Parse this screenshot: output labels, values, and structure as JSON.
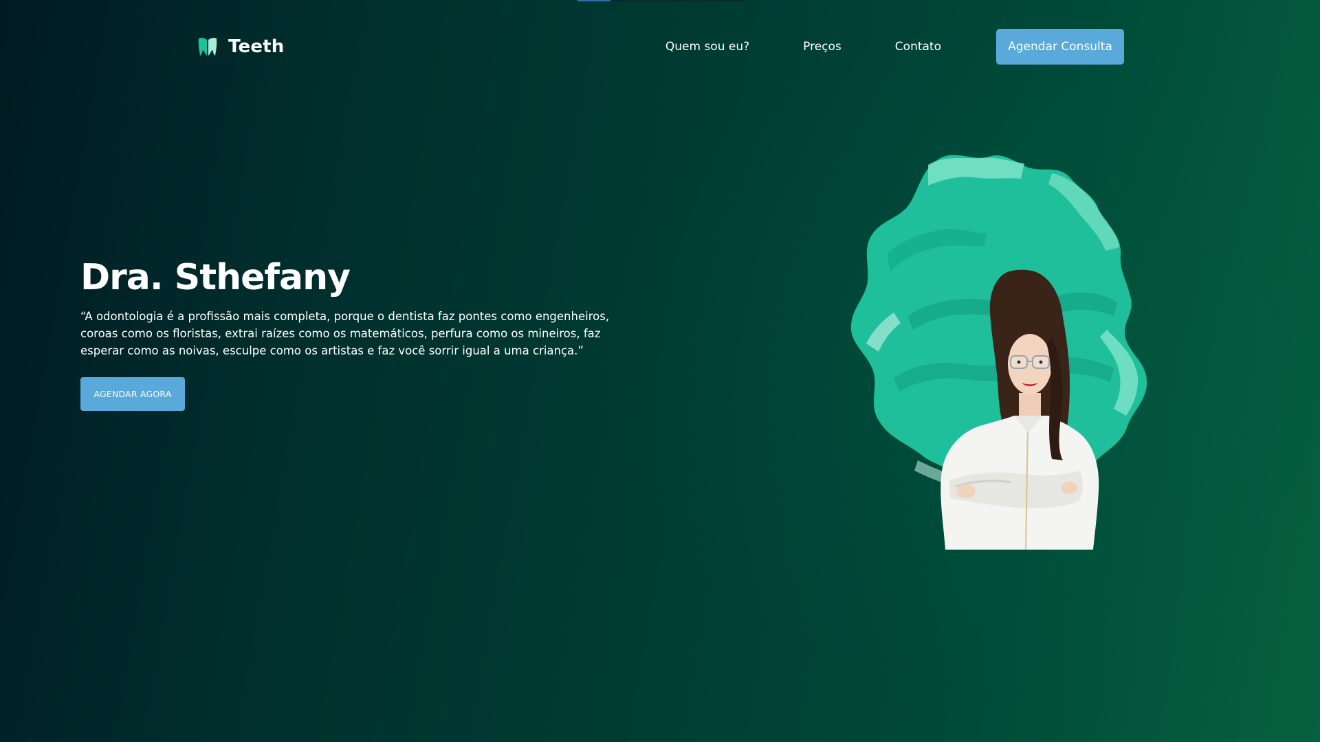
{
  "page": {
    "title": "Teeth - Dra. Sthefany"
  },
  "header": {
    "logo": {
      "icon": "tooth-icon",
      "name": "Teeth",
      "colors": [
        "#1fbf9c",
        "#a9e9d6"
      ]
    },
    "nav": [
      {
        "label": "Quem sou eu?"
      },
      {
        "label": "Preços"
      },
      {
        "label": "Contato"
      }
    ],
    "cta_label": "Agendar Consulta"
  },
  "hero": {
    "title": "Dra. Sthefany",
    "quote": "“A odontologia é a profissão mais completa, porque o dentista faz pontes como engenheiros, coroas como os floristas, extrai raízes como os matemáticos, perfura como os mineiros, faz esperar como as noivas, esculpe como os artistas e faz você sorrir igual a uma criança.”",
    "button_label": "AGENDAR AGORA",
    "image": "doctor-portrait-paint-splash"
  },
  "colors": {
    "accent_button": "#5aa9db",
    "splash": "#1fbf9c",
    "splash_light": "#7fe3c8",
    "bg_dark": "#001a22",
    "bg_green": "#06613f"
  }
}
